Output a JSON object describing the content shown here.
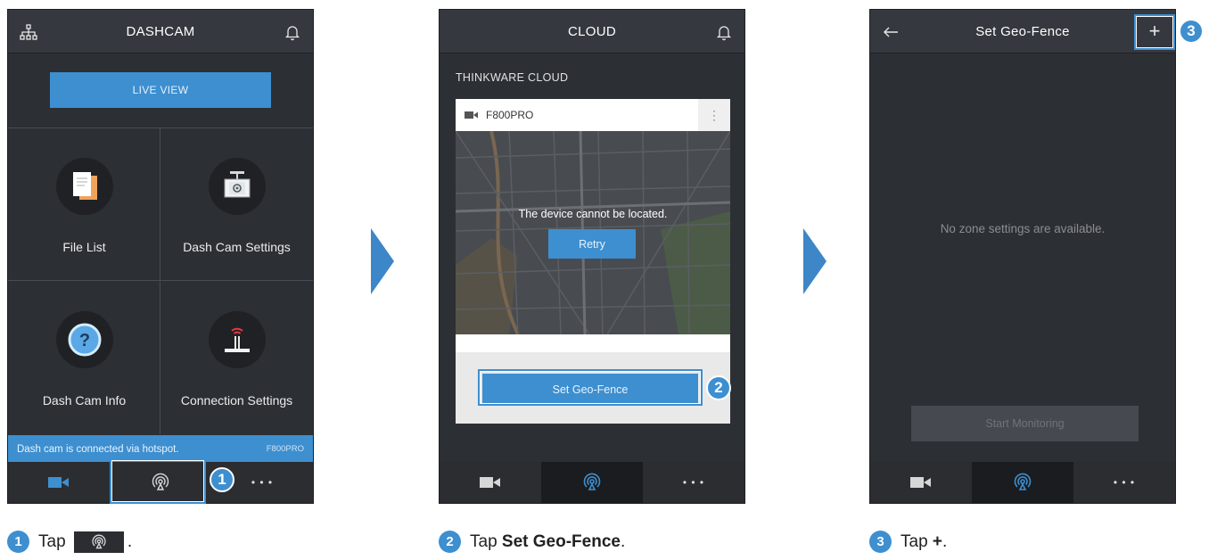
{
  "screen1": {
    "title": "DASHCAM",
    "live_view_label": "LIVE VIEW",
    "grid": [
      {
        "label": "File List",
        "icon": "file-list-icon"
      },
      {
        "label": "Dash Cam Settings",
        "icon": "dashcam-settings-icon"
      },
      {
        "label": "Dash Cam Info",
        "icon": "question-icon"
      },
      {
        "label": "Connection Settings",
        "icon": "router-icon"
      }
    ],
    "status_text": "Dash cam is connected via hotspot.",
    "status_device": "F800PRO",
    "badge": "1"
  },
  "screen2": {
    "title": "CLOUD",
    "section_title": "THINKWARE CLOUD",
    "device_name": "F800PRO",
    "more_label": "⋮",
    "map_message": "The device cannot be located.",
    "retry_label": "Retry",
    "geofence_label": "Set Geo-Fence",
    "badge": "2"
  },
  "screen3": {
    "title": "Set Geo-Fence",
    "add_label": "+",
    "empty_message": "No zone settings are available.",
    "monitor_label": "Start Monitoring",
    "badge": "3"
  },
  "tabs": {
    "more_label": "• • •"
  },
  "captions": [
    {
      "num": "1",
      "prefix": "Tap ",
      "bold": "",
      "suffix": "."
    },
    {
      "num": "2",
      "prefix": "Tap ",
      "bold": "Set Geo-Fence",
      "suffix": "."
    },
    {
      "num": "3",
      "prefix": "Tap ",
      "bold": "+",
      "suffix": "."
    }
  ],
  "colors": {
    "accent": "#3d8fd0",
    "background": "#2c2f34",
    "topbar": "#35383e"
  }
}
